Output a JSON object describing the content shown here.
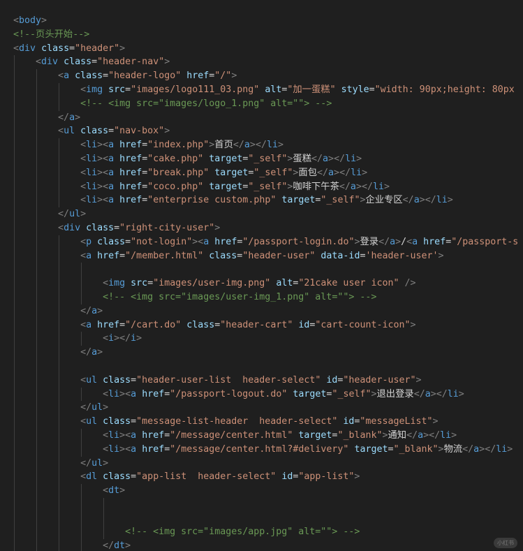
{
  "editor": {
    "theme_colors": {
      "background": "#1f1f1f",
      "punct": "#808080",
      "tag": "#569cd6",
      "attr": "#9cdcfe",
      "string": "#ce9178",
      "comment": "#6a9955",
      "text": "#d4d4d4"
    },
    "lines": [
      {
        "indent": 0,
        "code": "<body>"
      },
      {
        "indent": 0,
        "code": "<!--页头开始-->"
      },
      {
        "indent": 0,
        "code": "<div class=\"header\">"
      },
      {
        "indent": 1,
        "code": "<div class=\"header-nav\">"
      },
      {
        "indent": 2,
        "code": "<a class=\"header-logo\" href=\"/\">"
      },
      {
        "indent": 3,
        "code": "<img src=\"images/logo111_03.png\" alt=\"加一蛋糕\" style=\"width: 90px;height: 80px"
      },
      {
        "indent": 3,
        "code": "<!-- <img src=\"images/logo_1.png\" alt=\"\"> -->"
      },
      {
        "indent": 2,
        "code": "</a>"
      },
      {
        "indent": 2,
        "code": "<ul class=\"nav-box\">"
      },
      {
        "indent": 3,
        "code": "<li><a href=\"index.php\">首页</a></li>"
      },
      {
        "indent": 3,
        "code": "<li><a href=\"cake.php\" target=\"_self\">蛋糕</a></li>"
      },
      {
        "indent": 3,
        "code": "<li><a href=\"break.php\" target=\"_self\">面包</a></li>"
      },
      {
        "indent": 3,
        "code": "<li><a href=\"coco.php\" target=\"_self\">咖啡下午茶</a></li>"
      },
      {
        "indent": 3,
        "code": "<li><a href=\"enterprise custom.php\" target=\"_self\">企业专区</a></li>"
      },
      {
        "indent": 2,
        "code": "</ul>"
      },
      {
        "indent": 2,
        "code": "<div class=\"right-city-user\">"
      },
      {
        "indent": 3,
        "code": "<p class=\"not-login\"><a href=\"/passport-login.do\">登录</a>/<a href=\"/passport-s"
      },
      {
        "indent": 3,
        "code": "<a href=\"/member.html\" class=\"header-user\" data-id='header-user'>"
      },
      {
        "indent": 4,
        "code": ""
      },
      {
        "indent": 4,
        "code": "<img src=\"images/user-img.png\" alt=\"21cake user icon\" />"
      },
      {
        "indent": 4,
        "code": "<!-- <img src=\"images/user-img_1.png\" alt=\"\"> -->"
      },
      {
        "indent": 3,
        "code": "</a>"
      },
      {
        "indent": 3,
        "code": "<a href=\"/cart.do\" class=\"header-cart\" id=\"cart-count-icon\">"
      },
      {
        "indent": 4,
        "code": "<i></i>"
      },
      {
        "indent": 3,
        "code": "</a>"
      },
      {
        "indent": 3,
        "code": ""
      },
      {
        "indent": 3,
        "code": "<ul class=\"header-user-list  header-select\" id=\"header-user\">"
      },
      {
        "indent": 4,
        "code": "<li><a href=\"/passport-logout.do\" target=\"_self\">退出登录</a></li>"
      },
      {
        "indent": 3,
        "code": "</ul>"
      },
      {
        "indent": 3,
        "code": "<ul class=\"message-list-header  header-select\" id=\"messageList\">"
      },
      {
        "indent": 4,
        "code": "<li><a href=\"/message/center.html\" target=\"_blank\">通知</a></li>"
      },
      {
        "indent": 4,
        "code": "<li><a href=\"/message/center.html?#delivery\" target=\"_blank\">物流</a></li>"
      },
      {
        "indent": 3,
        "code": "</ul>"
      },
      {
        "indent": 3,
        "code": "<dl class=\"app-list  header-select\" id=\"app-list\">"
      },
      {
        "indent": 4,
        "code": "<dt>"
      },
      {
        "indent": 5,
        "code": ""
      },
      {
        "indent": 5,
        "code": ""
      },
      {
        "indent": 5,
        "code": "<!-- <img src=\"images/app.jpg\" alt=\"\"> -->"
      },
      {
        "indent": 4,
        "code": "</dt>"
      }
    ]
  },
  "watermark": "小红书"
}
